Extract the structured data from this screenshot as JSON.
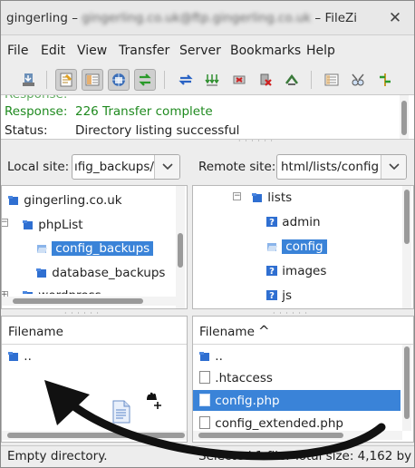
{
  "window": {
    "app_prefix": "gingerling – ",
    "title_obscured": "gingerling.co.uk@ftp.gingerling.co.uk",
    "app_suffix": " – FileZi",
    "close_glyph": "✕"
  },
  "menu": [
    "File",
    "Edit",
    "View",
    "Transfer",
    "Server",
    "Bookmarks",
    "Help"
  ],
  "toolbar": {
    "icons": [
      "site-manager",
      "toggle-message-log",
      "toggle-local-tree",
      "toggle-remote-tree",
      "toggle-transfer-queue",
      "refresh",
      "process-queue",
      "cancel",
      "disconnect",
      "reconnect",
      "directory-filters",
      "search",
      "compare"
    ]
  },
  "log": {
    "response_label": "Response:",
    "response_text": "226 Transfer complete",
    "status_label": "Status:",
    "status_text": "Directory listing successful",
    "response_color": "#1f8a1f"
  },
  "local": {
    "site_label": "Local site:",
    "path_value": "ıfig_backups/",
    "tree": [
      {
        "label": "gingerling.co.uk"
      },
      {
        "label": "phpList"
      },
      {
        "label": "config_backups",
        "selected": true
      },
      {
        "label": "database_backups"
      },
      {
        "label": "wordpress"
      }
    ],
    "column_filename": "Filename",
    "files": [
      ".."
    ],
    "status": "Empty directory."
  },
  "remote": {
    "site_label": "Remote site:",
    "path_value": "html/lists/config",
    "tree": [
      {
        "label": "lists"
      },
      {
        "label": "admin"
      },
      {
        "label": "config",
        "selected": true
      },
      {
        "label": "images"
      },
      {
        "label": "js"
      }
    ],
    "column_filename": "Filename",
    "sort_glyph": "^",
    "files": [
      "..",
      ".htaccess",
      "config.php",
      "config_extended.php"
    ],
    "selected_file": "config.php",
    "status": "Selected 1 file. Total size: 4,162 by"
  },
  "colors": {
    "selection": "#3a83d8",
    "folder": "#2f6fd1",
    "arrow": "#111111"
  }
}
